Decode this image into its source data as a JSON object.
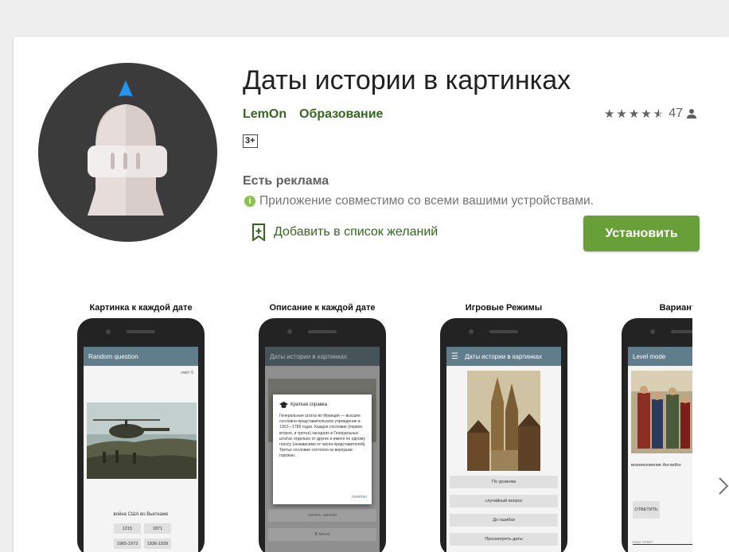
{
  "app": {
    "title": "Даты истории в картинках",
    "developer": "LemOn",
    "category": "Образование",
    "rating_count": "47",
    "age_rating": "3+",
    "ads_notice": "Есть реклама",
    "compatibility": "Приложение совместимо со всеми вашими устройствами.",
    "wishlist_label": "Добавить в список желаний",
    "install_label": "Установить",
    "rating_value": 4.5
  },
  "colors": {
    "brand_green": "#33691e",
    "install_green": "#689f38",
    "accent_blue": "#2196f3",
    "appbar": "#607d8b"
  },
  "icons": {
    "rating": "star-icon",
    "user": "person-icon",
    "info": "info-icon",
    "wishlist": "bookmark-plus-icon",
    "next": "chevron-right-icon"
  },
  "screenshots": [
    {
      "caption": "Картинка к каждой дате",
      "appbar": "Random question",
      "score": "счёт: 0",
      "question": "война США во Вьетнаме",
      "answers": [
        "1215",
        "1871",
        "1965-1973",
        "1936-1939"
      ]
    },
    {
      "caption": "Описание к каждой дате",
      "appbar": "Даты истории в картинках",
      "dialog_title": "Краткая справка",
      "dialog_text": "Генеральные штаты во Франции — высшее сословно-представительское учреждение в 1302—1789 годах. Каждое сословие (первое, второе, и третье) заседало в Генеральных штатах отдельно от других и имело по одному голосу (независимо от числа представителей). Третье сословие состояло из верхушки горожан.",
      "dialog_ok": "понятно",
      "buttons": [
        "начать заново",
        "В меню"
      ]
    },
    {
      "caption": "Игровые Режимы",
      "appbar": "Даты истории в картинках",
      "buttons": [
        "По уровням",
        "случайный вопрос",
        "До ошибки",
        "Просмотреть даты"
      ]
    },
    {
      "caption": "Варианты о",
      "appbar": "Level mode",
      "question": "возникновение Английск",
      "answer_button": "ОТВЕТИТЬ",
      "input_placeholder": "ваш ответ"
    }
  ]
}
